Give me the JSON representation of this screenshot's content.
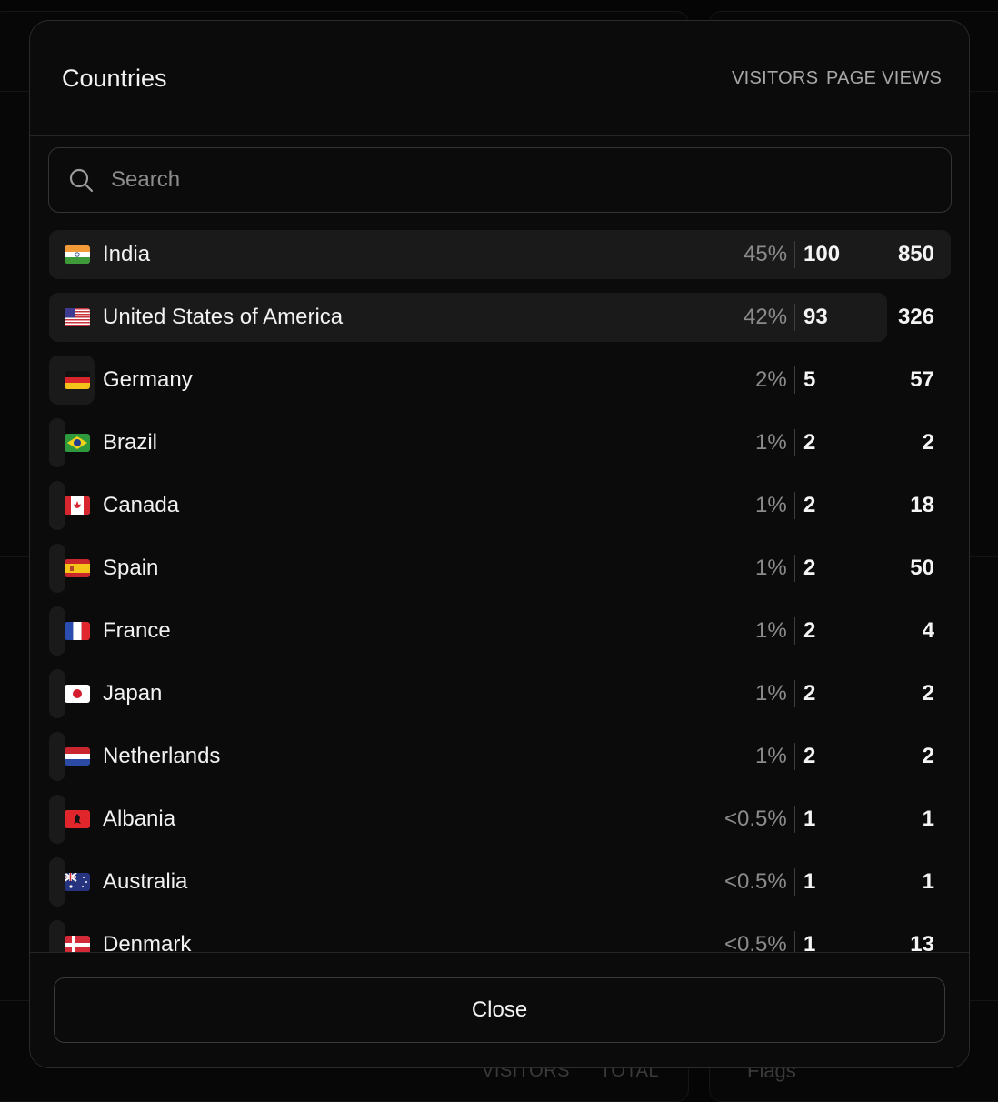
{
  "modal": {
    "title": "Countries",
    "columns": {
      "visitors": "VISITORS",
      "page_views": "PAGE VIEWS"
    },
    "search_placeholder": "Search",
    "close_label": "Close"
  },
  "rows": [
    {
      "country": "India",
      "flag": "flag-india-icon",
      "percent": "45%",
      "share": 0.45,
      "visitors": "100",
      "page_views": "850"
    },
    {
      "country": "United States of America",
      "flag": "flag-usa-icon",
      "percent": "42%",
      "share": 0.42,
      "visitors": "93",
      "page_views": "326"
    },
    {
      "country": "Germany",
      "flag": "flag-germany-icon",
      "percent": "2%",
      "share": 0.02,
      "visitors": "5",
      "page_views": "57"
    },
    {
      "country": "Brazil",
      "flag": "flag-brazil-icon",
      "percent": "1%",
      "share": 0.01,
      "visitors": "2",
      "page_views": "2"
    },
    {
      "country": "Canada",
      "flag": "flag-canada-icon",
      "percent": "1%",
      "share": 0.01,
      "visitors": "2",
      "page_views": "18"
    },
    {
      "country": "Spain",
      "flag": "flag-spain-icon",
      "percent": "1%",
      "share": 0.01,
      "visitors": "2",
      "page_views": "50"
    },
    {
      "country": "France",
      "flag": "flag-france-icon",
      "percent": "1%",
      "share": 0.01,
      "visitors": "2",
      "page_views": "4"
    },
    {
      "country": "Japan",
      "flag": "flag-japan-icon",
      "percent": "1%",
      "share": 0.01,
      "visitors": "2",
      "page_views": "2"
    },
    {
      "country": "Netherlands",
      "flag": "flag-netherlands-icon",
      "percent": "1%",
      "share": 0.01,
      "visitors": "2",
      "page_views": "2"
    },
    {
      "country": "Albania",
      "flag": "flag-albania-icon",
      "percent": "<0.5%",
      "share": 0.005,
      "visitors": "1",
      "page_views": "1"
    },
    {
      "country": "Australia",
      "flag": "flag-australia-icon",
      "percent": "<0.5%",
      "share": 0.005,
      "visitors": "1",
      "page_views": "1"
    },
    {
      "country": "Denmark",
      "flag": "flag-denmark-icon",
      "percent": "<0.5%",
      "share": 0.005,
      "visitors": "1",
      "page_views": "13"
    }
  ],
  "background": {
    "fragments": [
      "VISITORS",
      "TOTAL",
      "Flags"
    ]
  },
  "colors": {
    "background": "#050505",
    "modal": "#0b0b0b",
    "row_bar": "#1a1a1a",
    "muted_text": "#8b8b8b"
  }
}
